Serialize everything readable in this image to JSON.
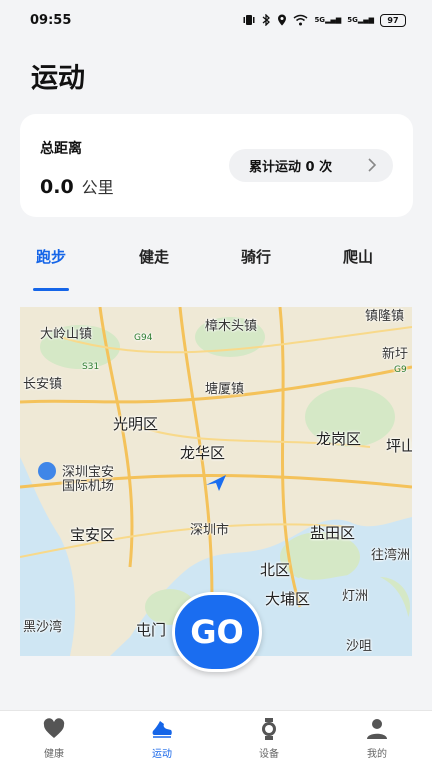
{
  "status_bar": {
    "time": "09:55",
    "battery": "97",
    "signal_label_1": "5G",
    "signal_label_2": "5G"
  },
  "header": {
    "title": "运动"
  },
  "summary": {
    "distance_label": "总距离",
    "distance_value": "0.0",
    "distance_unit": "公里",
    "count_label": "累计运动 0 次"
  },
  "tabs": [
    {
      "label": "跑步",
      "active": true
    },
    {
      "label": "健走",
      "active": false
    },
    {
      "label": "骑行",
      "active": false
    },
    {
      "label": "爬山",
      "active": false
    }
  ],
  "map": {
    "labels": [
      "大岭山镇",
      "樟木头镇",
      "镇隆镇",
      "新圩",
      "长安镇",
      "塘厦镇",
      "光明区",
      "龙华区",
      "龙岗区",
      "坪山",
      "深圳宝安",
      "国际机场",
      "宝安区",
      "深圳市",
      "盐田区",
      "往湾洲",
      "北区",
      "大埔区",
      "灯洲",
      "黑沙湾",
      "屯门",
      "沙咀"
    ],
    "road_labels": [
      "G94",
      "S31",
      "G9"
    ],
    "go_label": "GO"
  },
  "colors": {
    "accent": "#1565e8",
    "go": "#1a6df0"
  },
  "bottom_nav": [
    {
      "label": "健康",
      "icon": "heart-icon",
      "active": false
    },
    {
      "label": "运动",
      "icon": "running-shoe-icon",
      "active": true
    },
    {
      "label": "设备",
      "icon": "watch-icon",
      "active": false
    },
    {
      "label": "我的",
      "icon": "person-icon",
      "active": false
    }
  ]
}
